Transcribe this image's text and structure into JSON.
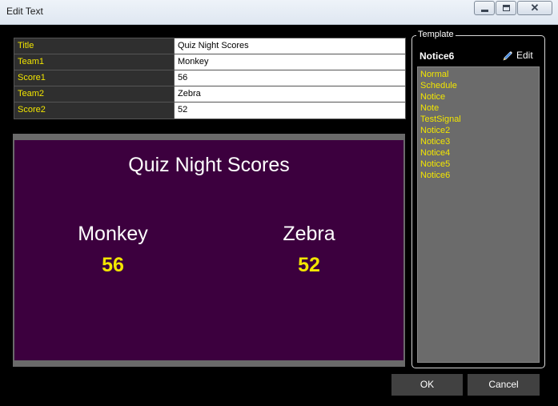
{
  "window": {
    "title": "Edit Text"
  },
  "fields": [
    {
      "name": "Title",
      "value": "Quiz Night Scores"
    },
    {
      "name": "Team1",
      "value": "Monkey"
    },
    {
      "name": "Score1",
      "value": "56"
    },
    {
      "name": "Team2",
      "value": "Zebra"
    },
    {
      "name": "Score2",
      "value": "52"
    }
  ],
  "preview": {
    "title": "Quiz Night Scores",
    "team1": "Monkey",
    "score1": "56",
    "team2": "Zebra",
    "score2": "52",
    "background_color": "#3c003e",
    "score_color": "#f2e600"
  },
  "template": {
    "legend": "Template",
    "selected": "Notice6",
    "edit_label": "Edit",
    "items": [
      "Normal",
      "Schedule",
      "Notice",
      "Note",
      "TestSignal",
      "Notice2",
      "Notice3",
      "Notice4",
      "Notice5",
      "Notice6"
    ]
  },
  "buttons": {
    "ok": "OK",
    "cancel": "Cancel"
  },
  "colors": {
    "label_yellow": "#f2e600",
    "panel_grey": "#6b6b6b",
    "button_grey": "#414141"
  }
}
